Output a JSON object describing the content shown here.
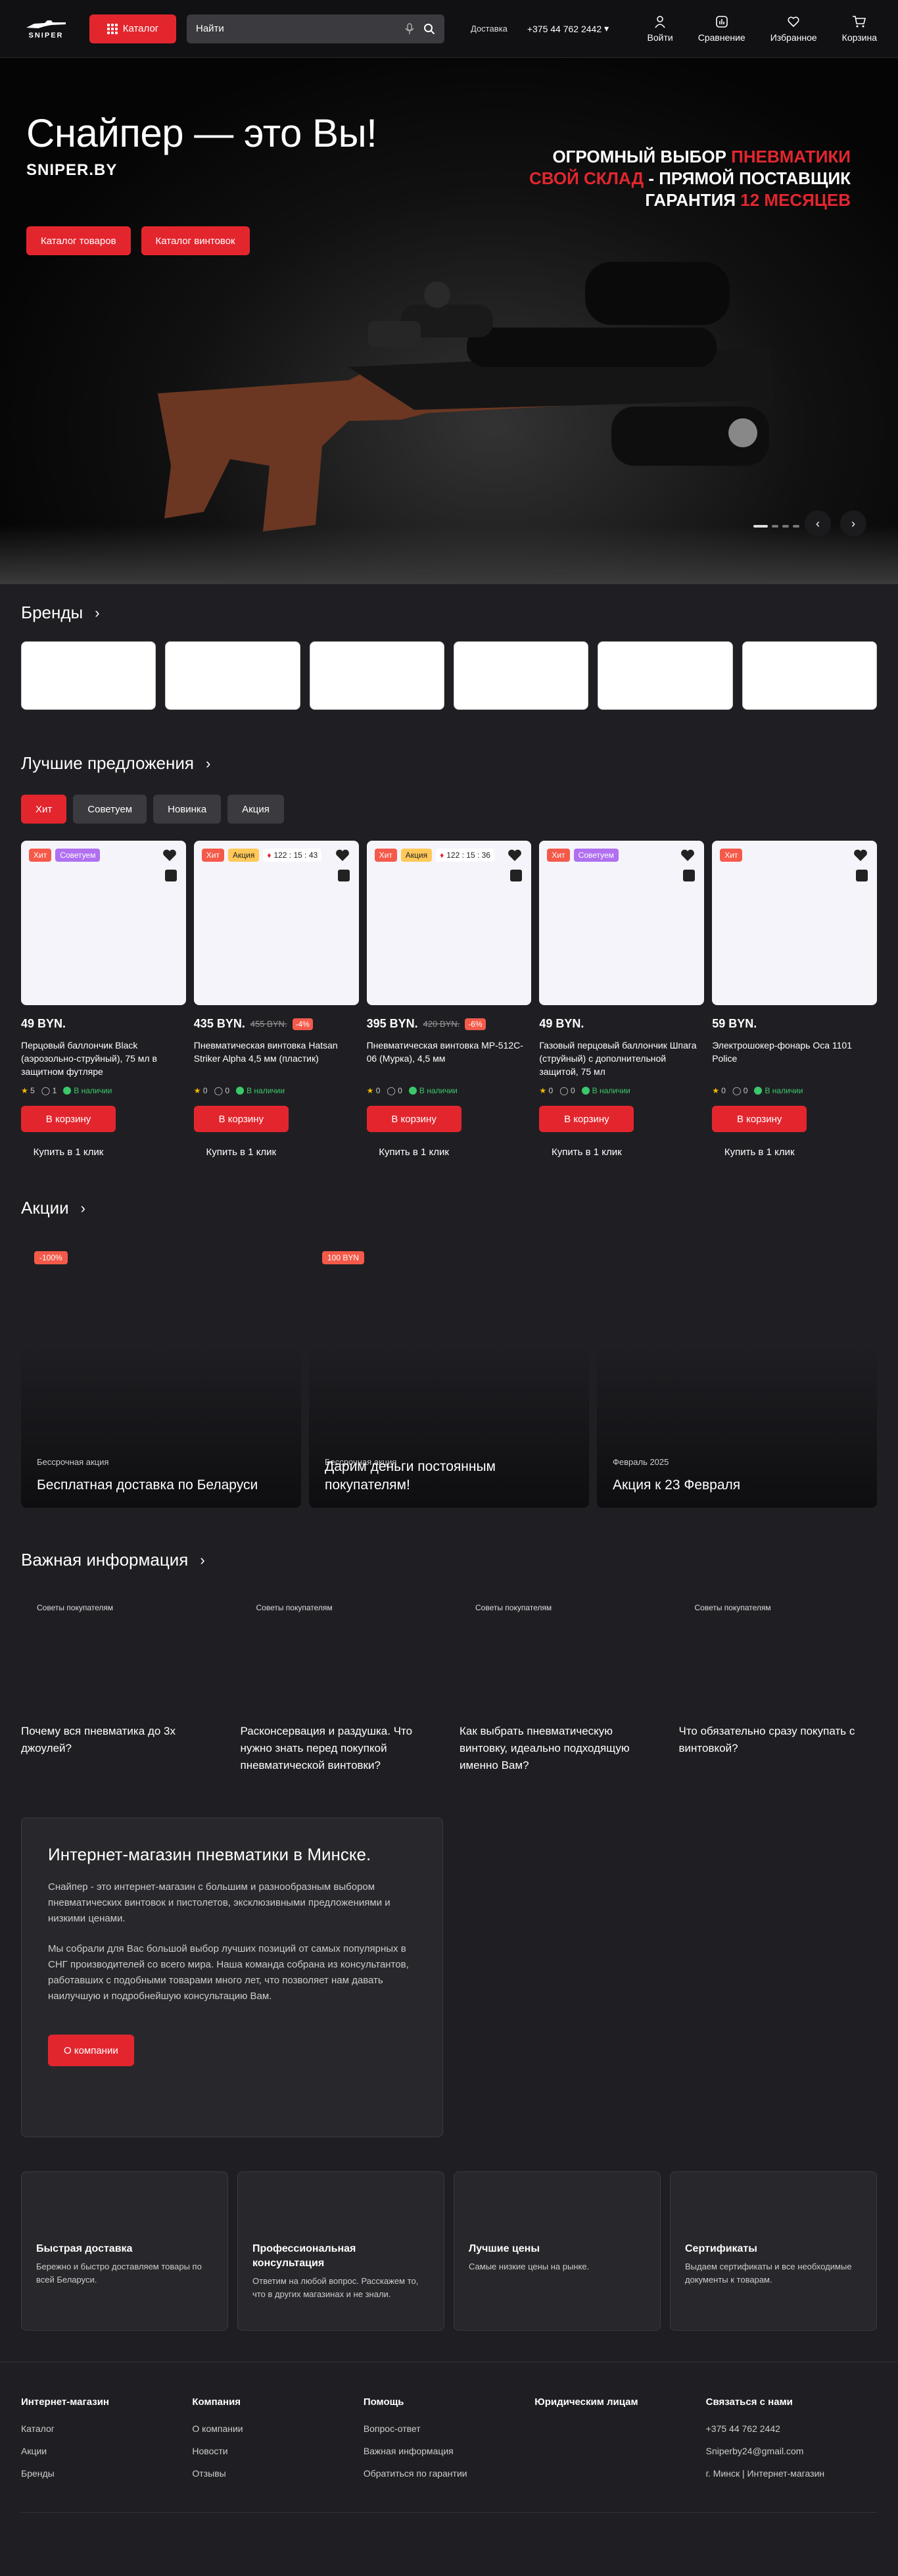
{
  "header": {
    "logo_text": "SNIPER",
    "catalog_label": "Каталог",
    "search_placeholder": "Найти",
    "delivery_label": "Доставка",
    "phone": "+375 44 762 2442",
    "actions": [
      {
        "label": "Войти",
        "icon": "user-icon"
      },
      {
        "label": "Сравнение",
        "icon": "compare-icon"
      },
      {
        "label": "Избранное",
        "icon": "heart-icon"
      },
      {
        "label": "Корзина",
        "icon": "cart-icon"
      }
    ]
  },
  "hero": {
    "title": "Снайпер — это Вы!",
    "site": "SNIPER.BY",
    "btn_catalog": "Каталог товаров",
    "btn_rifles": "Каталог винтовок",
    "tagline": {
      "l1_white": "ОГРОМНЫЙ ВЫБОР ",
      "l1_red": "ПНЕВМАТИКИ",
      "l2_red": "СВОЙ СКЛАД",
      "l2_white": " - ПРЯМОЙ ПОСТАВЩИК",
      "l3_white": "ГАРАНТИЯ ",
      "l3_red": "12 МЕСЯЦЕВ"
    },
    "prev": "‹",
    "next": "›"
  },
  "brands": {
    "title": "Бренды"
  },
  "offers": {
    "title": "Лучшие предложения",
    "tabs": [
      "Хит",
      "Советуем",
      "Новинка",
      "Акция"
    ],
    "cart_label": "В корзину",
    "buy1_label": "Купить в 1 клик",
    "instock_label": "В наличии",
    "products": [
      {
        "badges": [
          "Хит",
          "Советуем"
        ],
        "timer": "",
        "price": "49 BYN.",
        "old": "",
        "disc": "",
        "name": "Перцовый баллончик Black (аэрозольно-струйный), 75 мл в защитном футляре",
        "rating": "5",
        "reviews": "1"
      },
      {
        "badges": [
          "Хит",
          "Акция"
        ],
        "timer": "122 : 15 : 43",
        "price": "435 BYN.",
        "old": "455 BYN.",
        "disc": "-4%",
        "name": "Пневматическая винтовка Hatsan Striker Alpha 4,5 мм (пластик)",
        "rating": "0",
        "reviews": "0"
      },
      {
        "badges": [
          "Хит",
          "Акция"
        ],
        "timer": "122 : 15 : 36",
        "price": "395 BYN.",
        "old": "420 BYN.",
        "disc": "-6%",
        "name": "Пневматическая винтовка MP-512C-06 (Мурка), 4,5 мм",
        "rating": "0",
        "reviews": "0"
      },
      {
        "badges": [
          "Хит",
          "Советуем"
        ],
        "timer": "",
        "price": "49 BYN.",
        "old": "",
        "disc": "",
        "name": "Газовый перцовый баллончик Шпага (струйный) с дополнительной защитой, 75 мл",
        "rating": "0",
        "reviews": "0"
      },
      {
        "badges": [
          "Хит"
        ],
        "timer": "",
        "price": "59 BYN.",
        "old": "",
        "disc": "",
        "name": "Электрошокер-фонарь Оса 1101 Police",
        "rating": "0",
        "reviews": "0"
      }
    ]
  },
  "promos": {
    "title": "Акции",
    "items": [
      {
        "tag": "-100%",
        "type": "Бессрочная акция",
        "title": "Бесплатная доставка по Беларуси"
      },
      {
        "tag": "100 BYN",
        "type": "Бессрочная акция",
        "title": "Дарим деньги постоянным покупателям!"
      },
      {
        "tag": "",
        "type": "Февраль 2025",
        "title": "Акция к 23 Февраля"
      }
    ]
  },
  "info": {
    "title": "Важная информация",
    "category": "Советы покупателям",
    "items": [
      "Почему вся пневматика до 3х джоулей?",
      "Расконсервация и раздушка. Что нужно знать перед покупкой пневматической винтовки?",
      "Как выбрать пневматическую винтовку, идеально подходящую именно Вам?",
      "Что обязательно сразу покупать с винтовкой?"
    ]
  },
  "about": {
    "title": "Интернет-магазин пневматики в Минске.",
    "p1": "Снайпер - это интернет-магазин с большим и разнообразным выбором пневматических винтовок и пистолетов, эксклюзивными предложениями и низкими ценами.",
    "p2": "Мы собрали для Вас большой выбор лучших позиций от самых популярных в СНГ производителей со всего мира. Наша команда собрана из консультантов, работавших с подобными товарами много лет, что позволяет нам давать наилучшую и подробнейшую консультацию Вам.",
    "button": "О компании"
  },
  "features": [
    {
      "title": "Быстрая доставка",
      "text": "Бережно и быстро доставляем товары по всей Беларуси."
    },
    {
      "title": "Профессиональная консультация",
      "text": "Ответим на любой вопрос. Расскажем то, что в других магазинах и не знали."
    },
    {
      "title": "Лучшие цены",
      "text": "Самые низкие цены на рынке."
    },
    {
      "title": "Сертификаты",
      "text": "Выдаем сертификаты и все необходимые документы к товарам."
    }
  ],
  "footer": {
    "cols": [
      {
        "title": "Интернет-магазин",
        "links": [
          "Каталог",
          "Акции",
          "Бренды"
        ]
      },
      {
        "title": "Компания",
        "links": [
          "О компании",
          "Новости",
          "Отзывы"
        ]
      },
      {
        "title": "Помощь",
        "links": [
          "Вопрос-ответ",
          "Важная информация",
          "Обратиться по гарантии"
        ]
      },
      {
        "title": "Юридическим лицам",
        "links": []
      },
      {
        "title": "Связаться с нами",
        "links": [
          "+375 44 762 2442",
          "Sniperby24@gmail.com",
          "г. Минск | Интернет-магазин"
        ]
      }
    ]
  },
  "colors": {
    "accent": "#e3262e",
    "bg": "#1f1f23",
    "header_bg": "#111114",
    "stock": "#3cc86a"
  }
}
